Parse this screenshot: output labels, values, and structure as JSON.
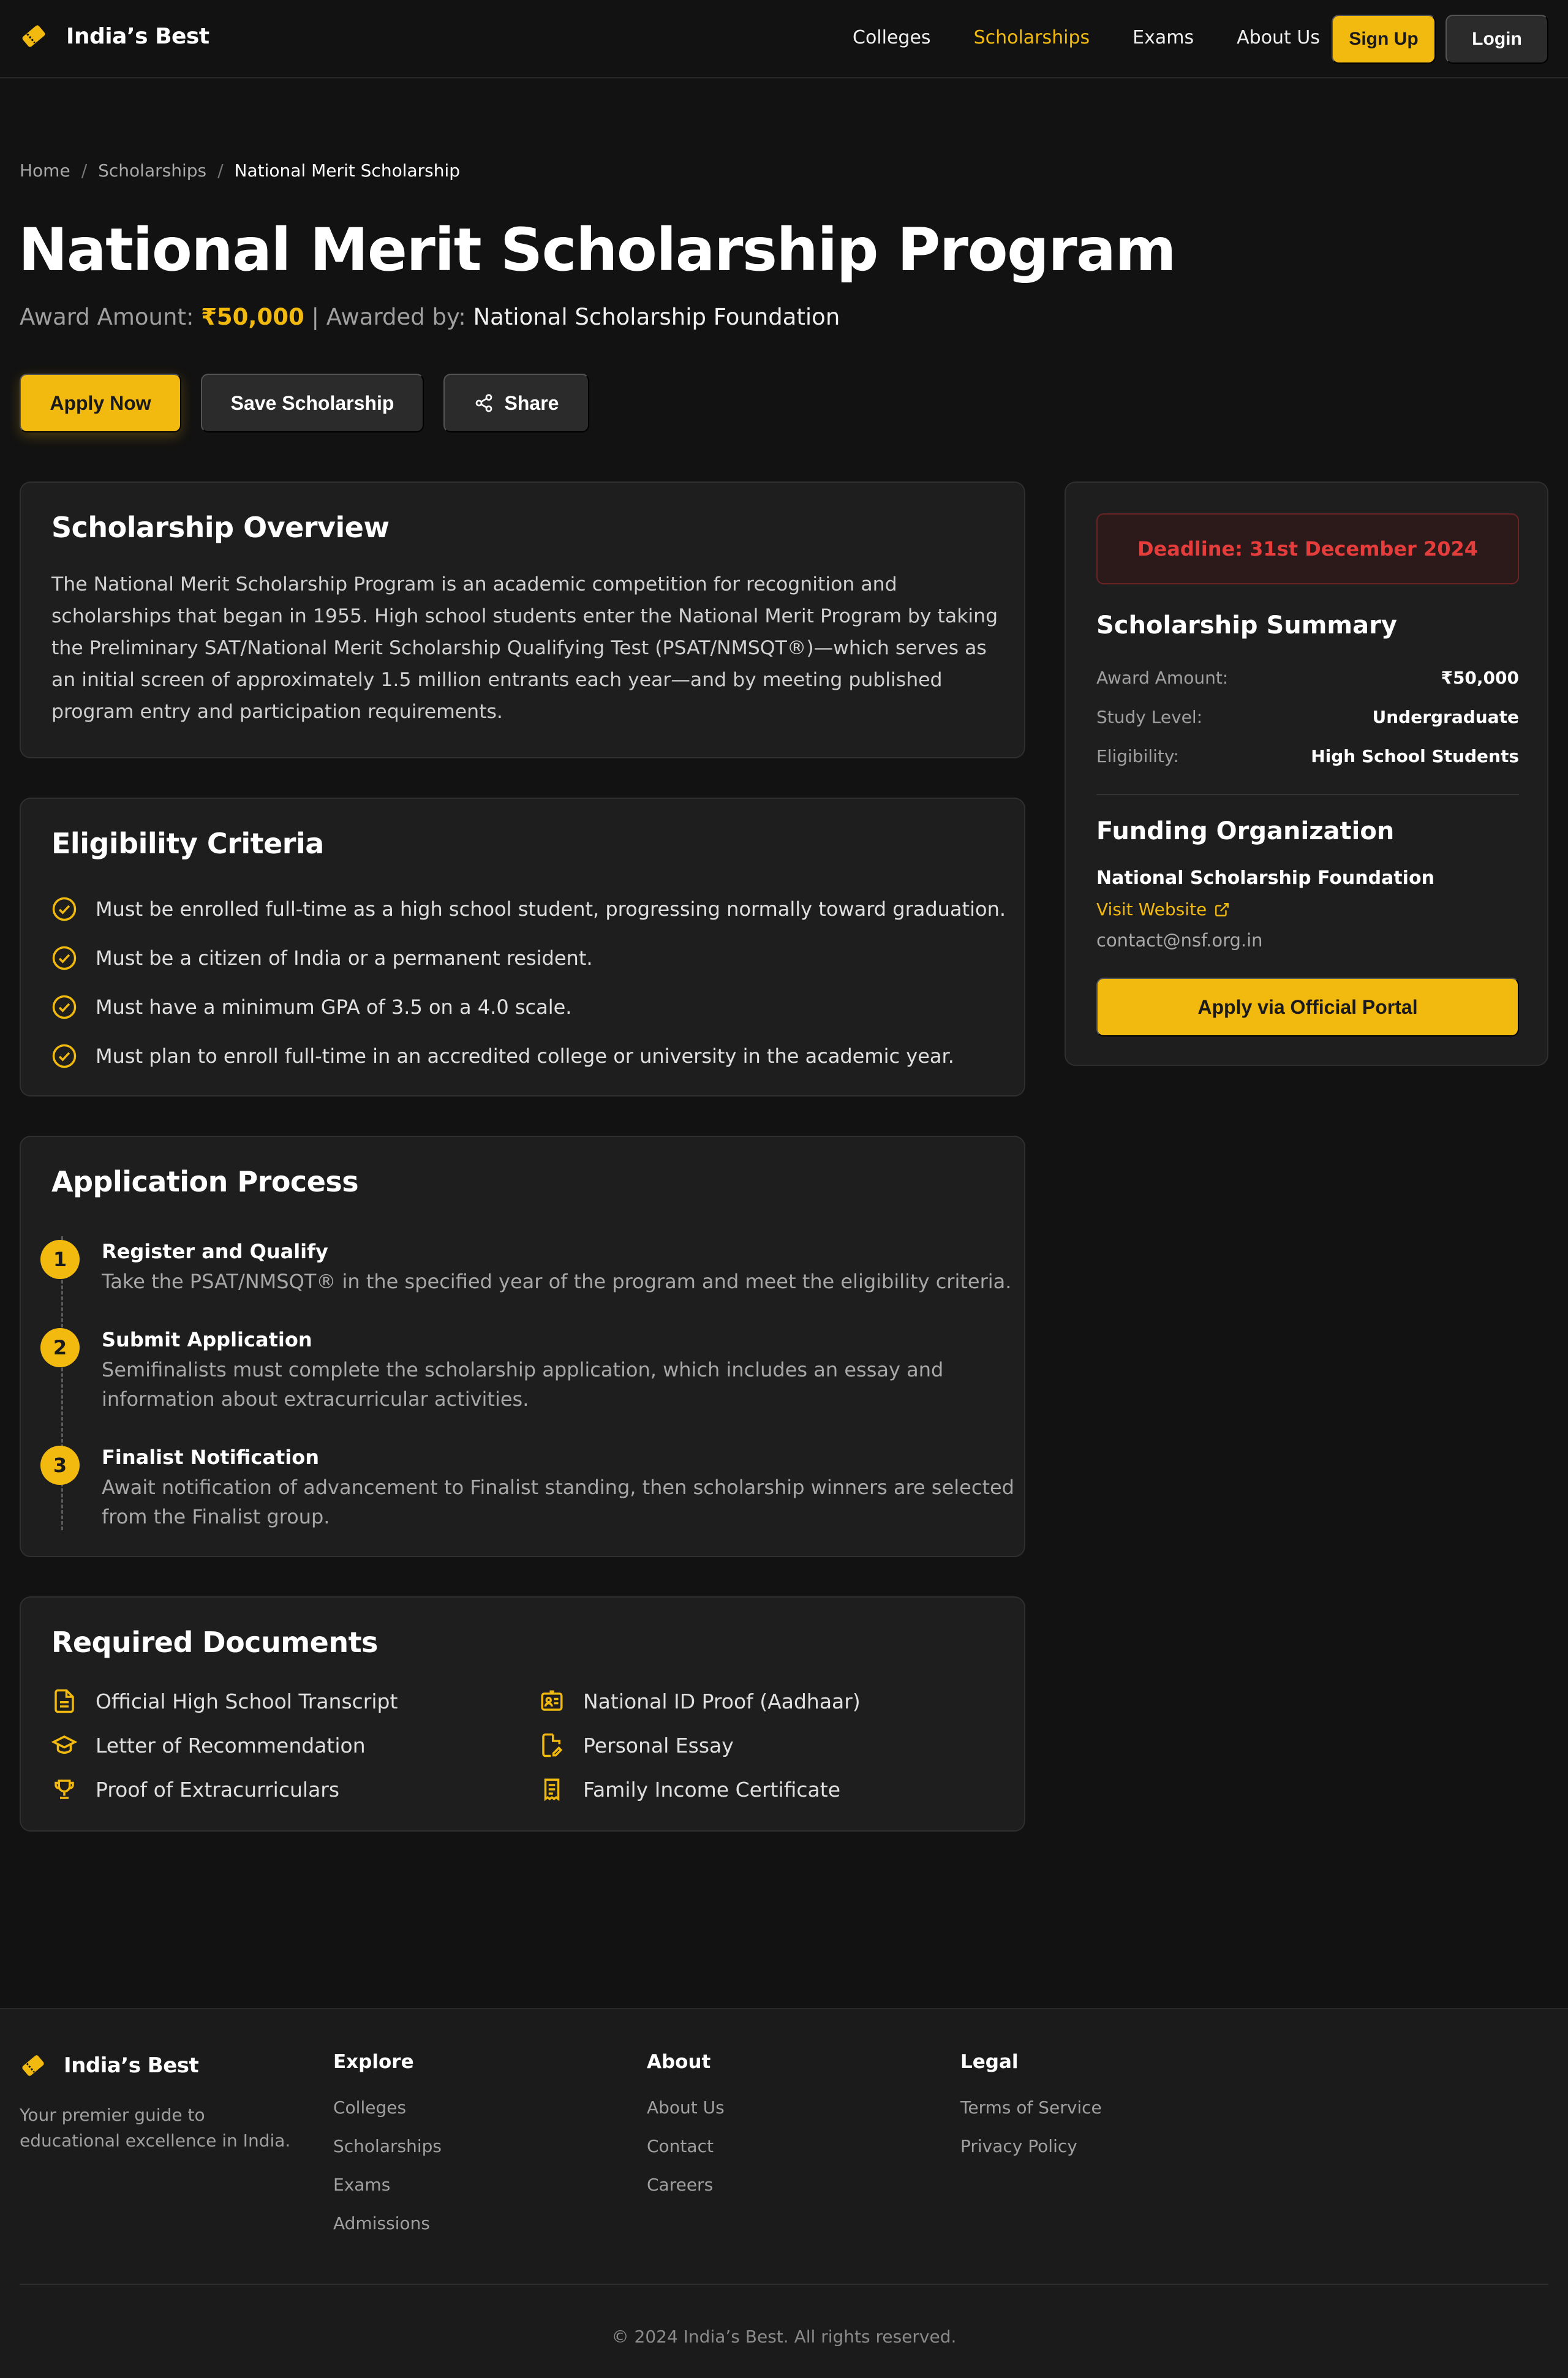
{
  "brand": {
    "name": "India’s Best"
  },
  "nav": {
    "links": [
      "Colleges",
      "Scholarships",
      "Exams",
      "About Us"
    ],
    "signup": "Sign Up",
    "login": "Login"
  },
  "breadcrumb": {
    "home": "Home",
    "section": "Scholarships",
    "current": "National Merit Scholarship",
    "sep": "/"
  },
  "page": {
    "title": "National Merit Scholarship Program",
    "award_label": "Award Amount:",
    "award_amount": "₹50,000",
    "divider": "|",
    "awarded_by_label": "Awarded by:",
    "awarded_by": "National Scholarship Foundation"
  },
  "actions": {
    "apply": "Apply Now",
    "save": "Save Scholarship",
    "share": "Share"
  },
  "overview": {
    "title": "Scholarship Overview",
    "text": "The National Merit Scholarship Program is an academic competition for recognition and scholarships that began in 1955. High school students enter the National Merit Program by taking the Preliminary SAT/National Merit Scholarship Qualifying Test (PSAT/NMSQT®)—which serves as an initial screen of approximately 1.5 million entrants each year—and by meeting published program entry and participation requirements."
  },
  "eligibility": {
    "title": "Eligibility Criteria",
    "items": [
      "Must be enrolled full-time as a high school student, progressing normally toward graduation.",
      "Must be a citizen of India or a permanent resident.",
      "Must have a minimum GPA of 3.5 on a 4.0 scale.",
      "Must plan to enroll full-time in an accredited college or university in the academic year."
    ]
  },
  "process": {
    "title": "Application Process",
    "steps": [
      {
        "num": "1",
        "title": "Register and Qualify",
        "desc": "Take the PSAT/NMSQT® in the specified year of the program and meet the eligibility criteria."
      },
      {
        "num": "2",
        "title": "Submit Application",
        "desc": "Semifinalists must complete the scholarship application, which includes an essay and information about extracurricular activities."
      },
      {
        "num": "3",
        "title": "Finalist Notification",
        "desc": "Await notification of advancement to Finalist standing, then scholarship winners are selected from the Finalist group."
      }
    ]
  },
  "documents": {
    "title": "Required Documents",
    "items": [
      {
        "label": "Official High School Transcript",
        "icon": "document-icon"
      },
      {
        "label": "National ID Proof (Aadhaar)",
        "icon": "id-card-icon"
      },
      {
        "label": "Letter of Recommendation",
        "icon": "graduation-cap-icon"
      },
      {
        "label": "Personal Essay",
        "icon": "file-edit-icon"
      },
      {
        "label": "Proof of Extracurriculars",
        "icon": "trophy-icon"
      },
      {
        "label": "Family Income Certificate",
        "icon": "receipt-icon"
      }
    ]
  },
  "sidebar": {
    "deadline": "Deadline: 31st December 2024",
    "summary_title": "Scholarship Summary",
    "summary": [
      {
        "k": "Award Amount:",
        "v": "₹50,000"
      },
      {
        "k": "Study Level:",
        "v": "Undergraduate"
      },
      {
        "k": "Eligibility:",
        "v": "High School Students"
      }
    ],
    "funding_title": "Funding Organization",
    "org_name": "National Scholarship Foundation",
    "visit": "Visit Website",
    "email": "contact@nsf.org.in",
    "portal_button": "Apply via Official Portal"
  },
  "footer": {
    "tagline": "Your premier guide to educational excellence in India.",
    "explore": {
      "title": "Explore",
      "links": [
        "Colleges",
        "Scholarships",
        "Exams",
        "Admissions"
      ]
    },
    "about": {
      "title": "About",
      "links": [
        "About Us",
        "Contact",
        "Careers"
      ]
    },
    "legal": {
      "title": "Legal",
      "links": [
        "Terms of Service",
        "Privacy Policy"
      ]
    },
    "copyright": "© 2024 India’s Best. All rights reserved."
  },
  "colors": {
    "accent": "#f2b90f",
    "background": "#121212",
    "card": "#1e1e1e",
    "deadline": "#e53c3c"
  }
}
